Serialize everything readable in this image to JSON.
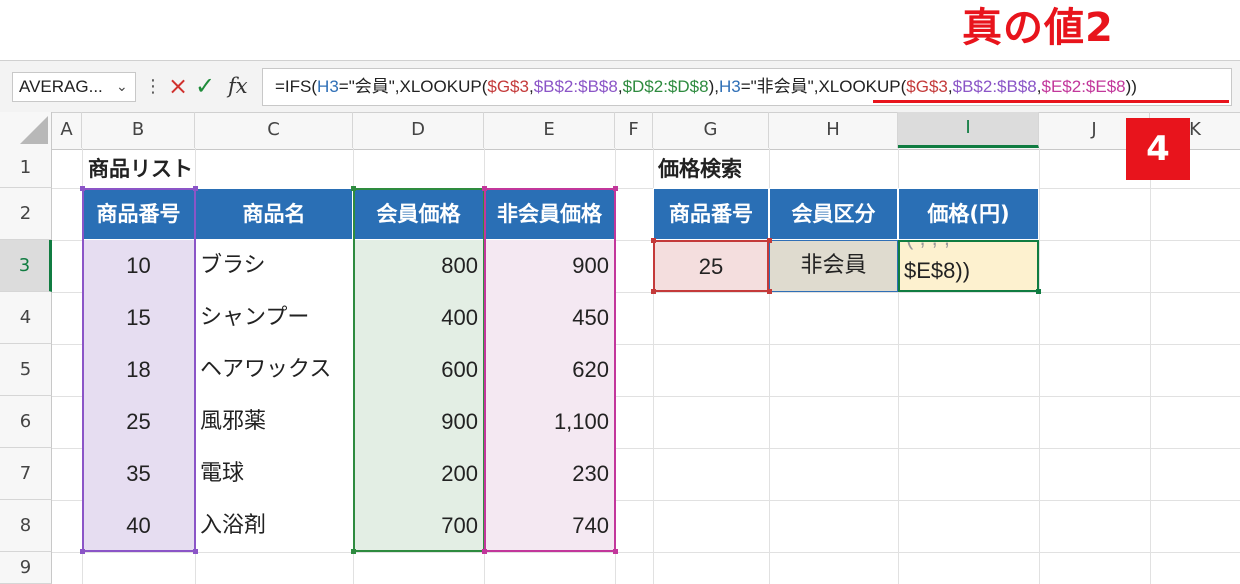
{
  "caption": "真の値2",
  "badge": "4",
  "formula_bar": {
    "name_box": "AVERAG...",
    "cancel_icon": "×",
    "enter_icon": "✓",
    "fx_label": "fx",
    "formula": {
      "p1": "=IFS(",
      "p2": "H3",
      "p3": "=\"会員\",XLOOKUP(",
      "p4": "$G$3",
      "p5": ",",
      "p6": "$B$2:$B$8",
      "p7": ",",
      "p8": "$D$2:$D$8",
      "p9": "),",
      "p10": "H3",
      "p11": "=\"非会員\",",
      "p12": "XLOOKUP(",
      "p13": "$G$3",
      "p14": ",",
      "p15": "$B$2:$B$8",
      "p16": ",",
      "p17": "$E$2:$E$8",
      "p18": "))"
    }
  },
  "columns": [
    "A",
    "B",
    "C",
    "D",
    "E",
    "F",
    "G",
    "H",
    "I",
    "J",
    "K"
  ],
  "rows": [
    "1",
    "2",
    "3",
    "4",
    "5",
    "6",
    "7",
    "8",
    "9"
  ],
  "product_list": {
    "title": "商品リスト",
    "headers": [
      "商品番号",
      "商品名",
      "会員価格",
      "非会員価格"
    ],
    "rows": [
      [
        "10",
        "ブラシ",
        "800",
        "900"
      ],
      [
        "15",
        "シャンプー",
        "400",
        "450"
      ],
      [
        "18",
        "ヘアワックス",
        "600",
        "620"
      ],
      [
        "25",
        "風邪薬",
        "900",
        "1,100"
      ],
      [
        "35",
        "電球",
        "200",
        "230"
      ],
      [
        "40",
        "入浴剤",
        "700",
        "740"
      ]
    ]
  },
  "price_search": {
    "title": "価格検索",
    "headers": [
      "商品番号",
      "会員区分",
      "価格(円)"
    ],
    "product_no": "25",
    "member_type": "非会員",
    "price_cell_text": "$E$8))",
    "price_cell_overflow": "(  ,  ,  ,"
  }
}
